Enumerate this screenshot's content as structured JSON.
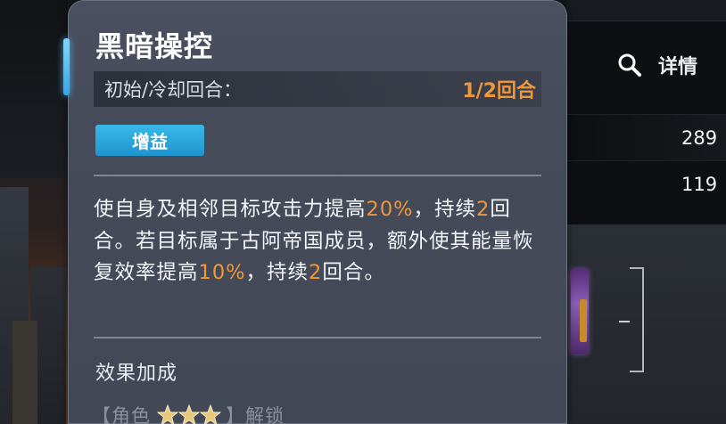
{
  "skill": {
    "title": "黑暗操控",
    "cooldown_label": "初始/冷却回合：",
    "cooldown_value": "1/2回合",
    "tag": "增益",
    "desc": {
      "t1": "使自身及相邻目标攻击力提高",
      "v1": "20%",
      "t2": "，持续",
      "v2": "2",
      "t3": "回合。若目标属于古阿帝国成员，额外使其能量恢复效率提高",
      "v3": "10%",
      "t4": "，持续",
      "v4": "2",
      "t5": "回合。"
    },
    "bonus_title": "效果加成",
    "unlock": {
      "prefix": "【角色",
      "stars": 3,
      "suffix": "】解锁"
    }
  },
  "right_panel": {
    "details_label": "详情",
    "details_icon": "search-icon",
    "stats": [
      "289",
      "119"
    ]
  },
  "colors": {
    "highlight": "#f0973a",
    "tag_bg": "#2aa8dc",
    "card_bg": "#454b59"
  }
}
